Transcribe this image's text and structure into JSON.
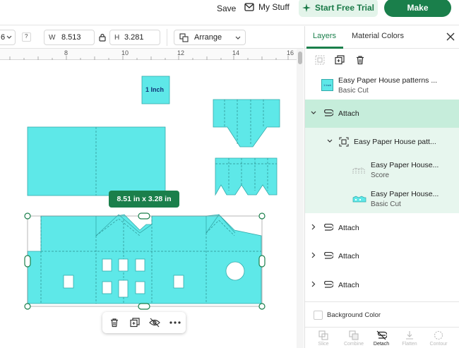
{
  "topbar": {
    "save_label": "Save",
    "mystuff_label": "My Stuff",
    "trial_label": "Start Free Trial",
    "make_label": "Make"
  },
  "toolbar": {
    "width_label": "W",
    "width_value": "8.513",
    "height_label": "H",
    "height_value": "3.281",
    "arrange_label": "Arrange",
    "help_label": "?",
    "left_num": "6"
  },
  "ruler": {
    "ticks": [
      "8",
      "10",
      "12",
      "14",
      "16"
    ]
  },
  "canvas": {
    "one_inch_label": "1 Inch",
    "selection_size": "8.51 in x 3.28 in",
    "accent_color": "#5ee8e8",
    "handle_color": "#1a7f4b"
  },
  "panel": {
    "tab_layers": "Layers",
    "tab_material": "Material Colors",
    "layers": [
      {
        "title": "Easy Paper House patterns ...",
        "sub": "Basic Cut",
        "thumb_label": "1 Inch"
      },
      {
        "title": "Attach"
      },
      {
        "title": "Easy Paper House patt..."
      },
      {
        "title": "Easy Paper House...",
        "sub": "Score"
      },
      {
        "title": "Easy Paper House...",
        "sub": "Basic Cut"
      },
      {
        "title": "Attach"
      },
      {
        "title": "Attach"
      },
      {
        "title": "Attach"
      }
    ],
    "background_label": "Background Color",
    "bottom": [
      "Slice",
      "Combine",
      "Detach",
      "Flatten",
      "Contour"
    ]
  }
}
